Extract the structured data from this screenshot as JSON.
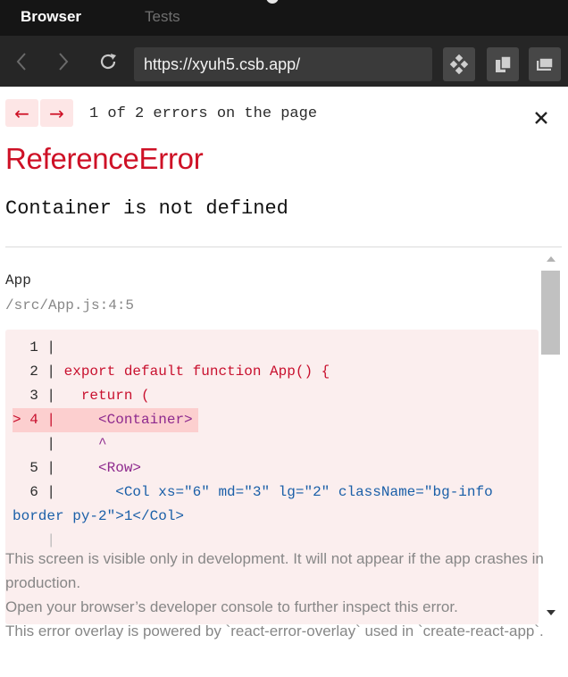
{
  "tabs": {
    "active": "Browser",
    "inactive": "Tests"
  },
  "toolbar": {
    "back_icon": "chevron-left-icon",
    "forward_icon": "chevron-right-icon",
    "refresh_icon": "refresh-icon",
    "url": "https://xyuh5.csb.app/",
    "tools": [
      "codesandbox-icon",
      "split-view-icon",
      "new-window-icon"
    ]
  },
  "overlay": {
    "prev_arrow": "←",
    "next_arrow": "→",
    "error_count": "1 of 2 errors on the page",
    "error_type": "ReferenceError",
    "error_message": "Container is not defined",
    "frame": {
      "name": "App",
      "location": "/src/App.js:4:5"
    },
    "code_lines": [
      {
        "gutter": "  1 |",
        "text": ""
      },
      {
        "gutter": "  2 |",
        "text": " export default function App() {"
      },
      {
        "gutter": "  3 |",
        "text": "   return ("
      },
      {
        "gutter": "> 4 |",
        "text": "     <Container>"
      },
      {
        "gutter": "    |",
        "text": "     ^"
      },
      {
        "gutter": "  5 |",
        "text": "     <Row>"
      },
      {
        "gutter": "  6 |",
        "text": "       <Col xs=\"6\" md=\"3\" lg=\"2\" className=\"bg-info"
      },
      {
        "gutter": "",
        "text": "border py-2\">1</Col>"
      }
    ],
    "footer": [
      "This screen is visible only in development. It will not appear if the app crashes in production.",
      "Open your browser’s developer console to further inspect this error.",
      "This error overlay is powered by `react-error-overlay` used in `create-react-app`."
    ]
  },
  "colors": {
    "error_red": "#ce1126",
    "code_bg": "#fbeeee",
    "highlight_bg": "#fccfcf"
  }
}
